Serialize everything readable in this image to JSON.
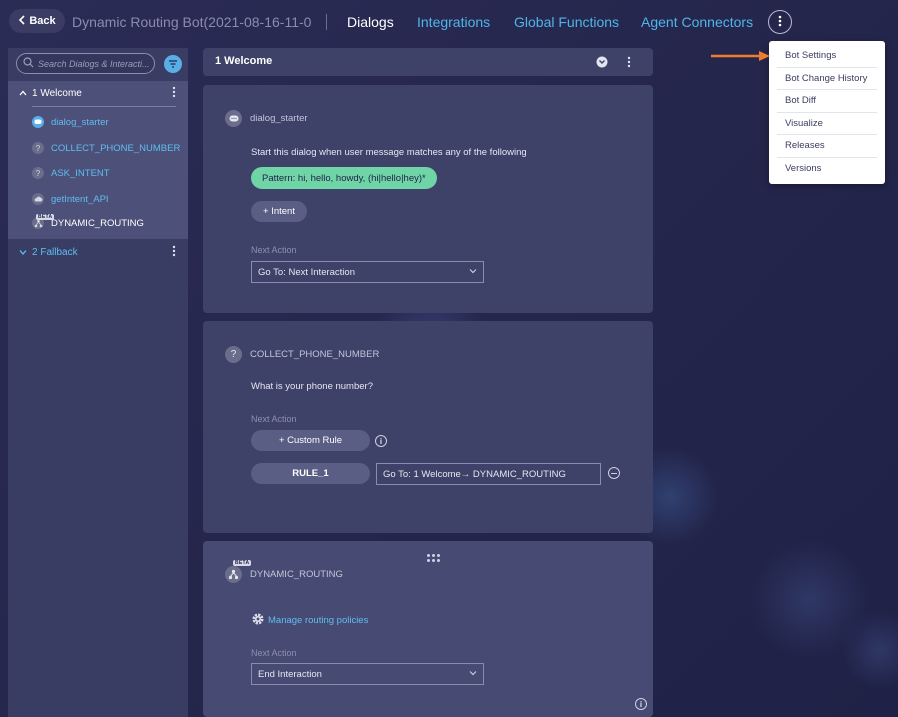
{
  "header": {
    "back_label": "Back",
    "bot_title": "Dynamic Routing Bot(2021-08-16-11-0...",
    "nav": [
      {
        "label": "Dialogs"
      },
      {
        "label": "Integrations"
      },
      {
        "label": "Global Functions"
      },
      {
        "label": "Agent Connectors"
      }
    ]
  },
  "sidebar": {
    "search_placeholder": "Search Dialogs & Interacti...",
    "groups": [
      {
        "label": "1 Welcome",
        "expanded": true
      },
      {
        "label": "2 Fallback",
        "expanded": false
      }
    ],
    "items": [
      {
        "label": "dialog_starter",
        "icon": "chat-bubble-icon"
      },
      {
        "label": "COLLECT_PHONE_NUMBER",
        "icon": "question-icon"
      },
      {
        "label": "ASK_INTENT",
        "icon": "question-icon"
      },
      {
        "label": "getIntent_API",
        "icon": "cloud-icon"
      },
      {
        "label": "DYNAMIC_ROUTING",
        "icon": "routing-icon",
        "badge": "BETA"
      }
    ]
  },
  "main": {
    "title": "1 Welcome",
    "cards": {
      "starter": {
        "type_label": "dialog_starter",
        "description": "Start this dialog when user message matches any of the following",
        "pattern": "Pattern:  hi, hello, howdy, (hi|hello|hey)*",
        "intent_button": "+ Intent",
        "next_action_label": "Next Action",
        "next_action_value": "Go To:  Next Interaction"
      },
      "collect": {
        "type_label": "COLLECT_PHONE_NUMBER",
        "question": "What is your phone number?",
        "next_action_label": "Next Action",
        "custom_rule_button": "+ Custom Rule",
        "rule_name": "RULE_1",
        "rule_value": "Go To: 1 Welcome→  DYNAMIC_ROUTING"
      },
      "routing": {
        "type_label": "DYNAMIC_ROUTING",
        "badge": "BETA",
        "manage_link": "Manage routing policies",
        "next_action_label": "Next Action",
        "next_action_value": "End Interaction"
      }
    }
  },
  "menu": {
    "items": [
      {
        "label": "Bot Settings"
      },
      {
        "label": "Bot Change History"
      },
      {
        "label": "Bot Diff"
      },
      {
        "label": "Visualize"
      },
      {
        "label": "Releases"
      },
      {
        "label": "Versions"
      }
    ]
  },
  "colors": {
    "accent": "#4fb5e8",
    "pattern_pill": "#6fd5a7",
    "arrow": "#f07d2e"
  }
}
